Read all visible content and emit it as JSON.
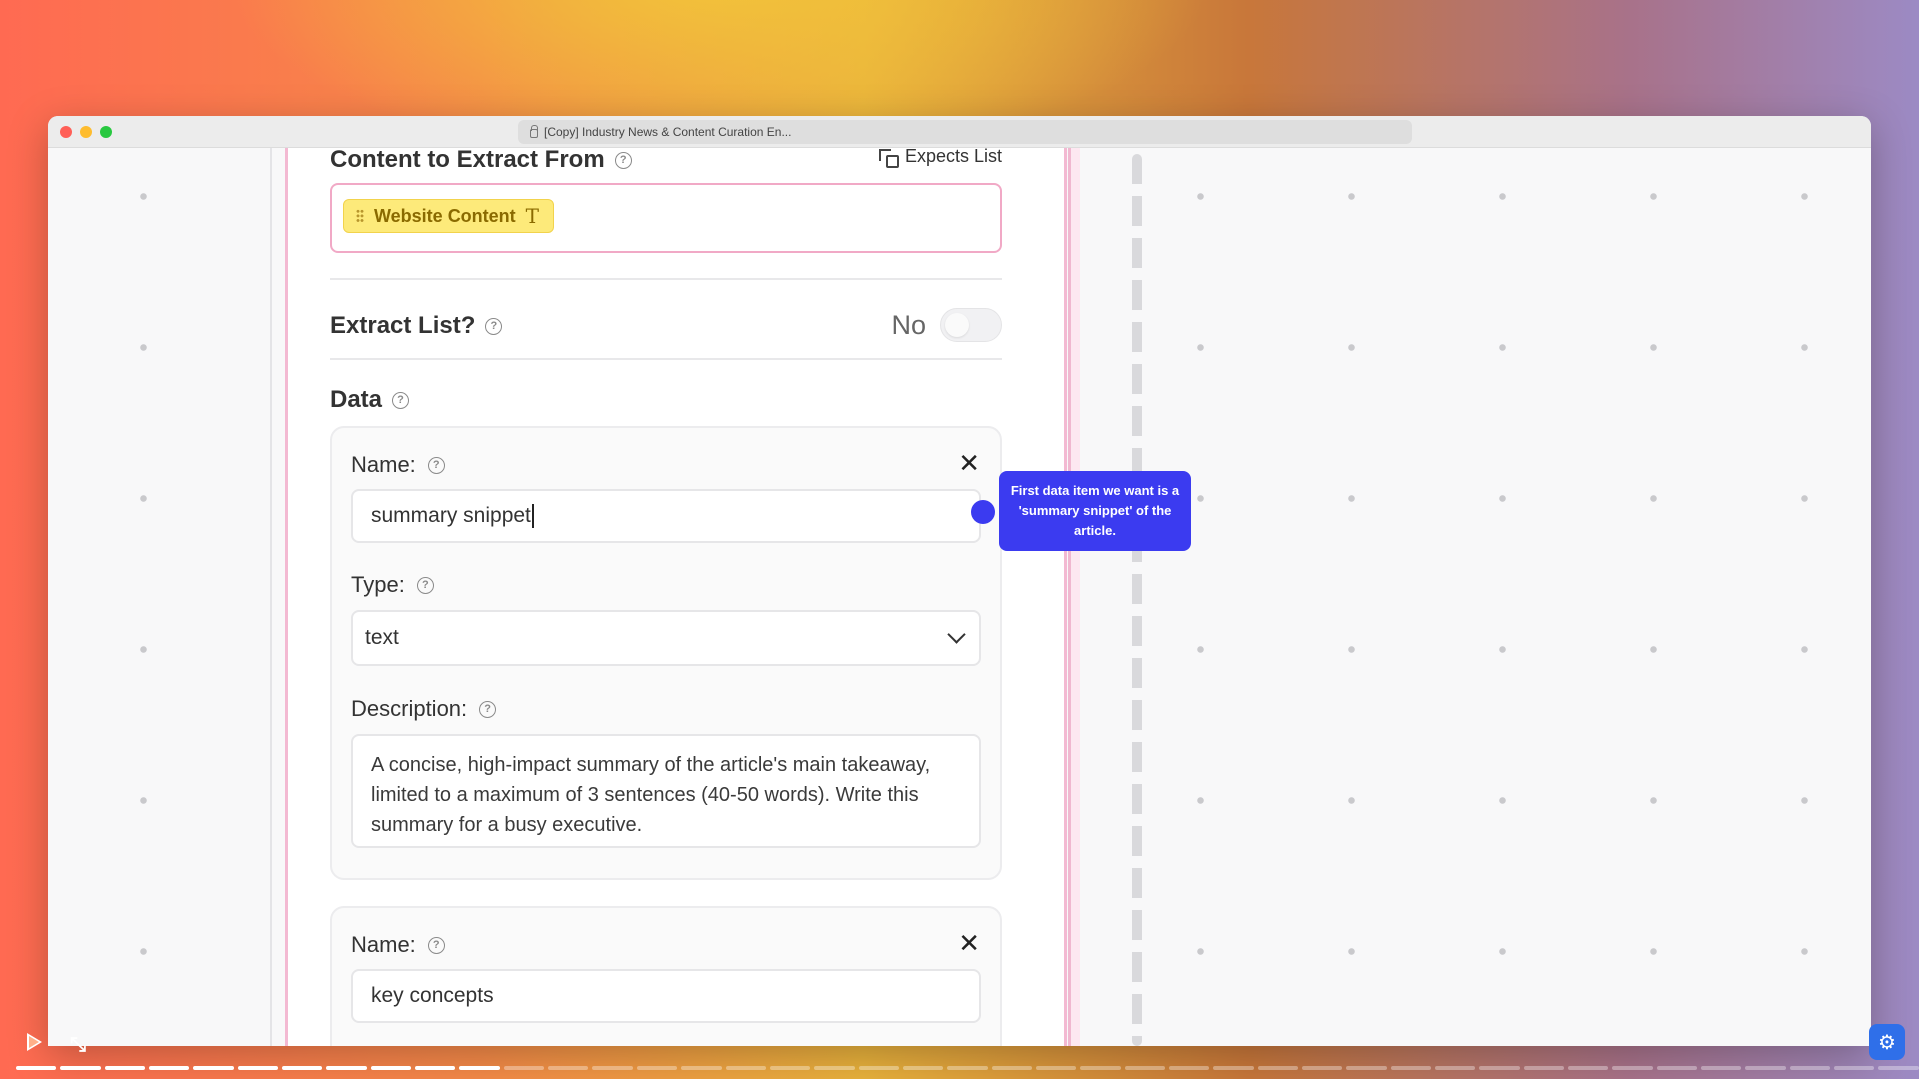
{
  "browser": {
    "url_title": "[Copy] Industry News & Content Curation En..."
  },
  "section_content": {
    "title": "Content to Extract From",
    "expects_label": "Expects List",
    "pill_label": "Website Content",
    "pill_type_glyph": "T"
  },
  "extract_list": {
    "title": "Extract List?",
    "toggle_label": "No"
  },
  "data_section": {
    "title": "Data"
  },
  "items": [
    {
      "name_label": "Name:",
      "name_value": "summary snippet",
      "type_label": "Type:",
      "type_value": "text",
      "description_label": "Description:",
      "description_value": "A concise, high-impact summary of the article's main takeaway, limited to a maximum of 3 sentences (40-50 words). Write this summary for a busy executive."
    },
    {
      "name_label": "Name:",
      "name_value": "key concepts"
    }
  ],
  "tooltip": {
    "text": "First data item we want is a 'summary snippet' of the article."
  },
  "player": {
    "segments_total": 43,
    "segments_done": 11,
    "accent": "#3b3bf0"
  }
}
